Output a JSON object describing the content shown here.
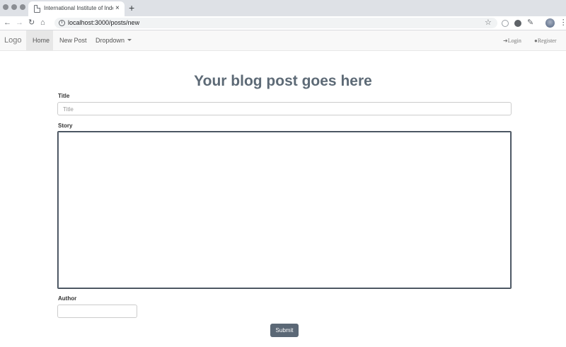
{
  "browser": {
    "tab_title": "International Institute of Indepe",
    "tab_close": "×",
    "new_tab": "+",
    "url": "localhost:3000/posts/new",
    "icons": [
      "favicon-page-icon",
      "back-icon",
      "forward-icon",
      "reload-icon",
      "home-icon",
      "info-icon",
      "star-icon",
      "extension-icons",
      "profile-avatar-icon",
      "menu-icon"
    ]
  },
  "navbar": {
    "brand": "Logo",
    "links": [
      {
        "label": "Home",
        "active": true
      },
      {
        "label": "New Post",
        "active": false
      },
      {
        "label": "Dropdown",
        "active": false
      }
    ],
    "login": "Login",
    "register": "Register"
  },
  "form": {
    "heading": "Your blog post goes here",
    "title_label": "Title",
    "title_placeholder": "Title",
    "title_value": "",
    "story_label": "Story",
    "story_value": "",
    "author_label": "Author",
    "author_value": "",
    "submit_label": "Submit"
  },
  "colors": {
    "heading": "#5d6a76",
    "submit_bg": "#5b6876",
    "navbar_bg": "#f8f8f8",
    "active_nav_bg": "#e7e7e7"
  }
}
